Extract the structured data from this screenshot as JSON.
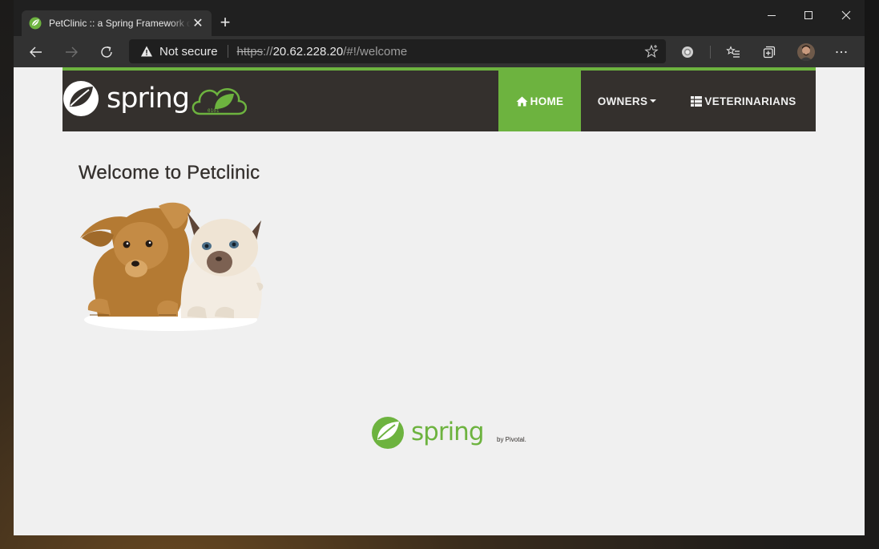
{
  "browser": {
    "tab_title": "PetClinic :: a Spring Framework demonstration",
    "tab_close": "✕",
    "new_tab": "+",
    "security_label": "Not secure",
    "url_scheme": "https",
    "url_separator": "://",
    "url_host": "20.62.228.20",
    "url_path": "/#!/welcome",
    "controls": [
      "minimize",
      "maximize",
      "close"
    ]
  },
  "navbar": {
    "brand_alt": "spring",
    "items": [
      {
        "label": "HOME",
        "icon": "home-icon",
        "active": true
      },
      {
        "label": "OWNERS",
        "icon": "caret-down-icon",
        "active": false
      },
      {
        "label": "VETERINARIANS",
        "icon": "th-list-icon",
        "active": false
      }
    ]
  },
  "main": {
    "heading": "Welcome to Petclinic",
    "image_alt": "pets"
  },
  "footer": {
    "logo_text": "spring",
    "byline": "by Pivotal."
  },
  "colors": {
    "spring_green": "#6db33f",
    "navbar_bg": "#34302d",
    "page_bg": "#f0f0f0",
    "browser_chrome": "#202020"
  }
}
